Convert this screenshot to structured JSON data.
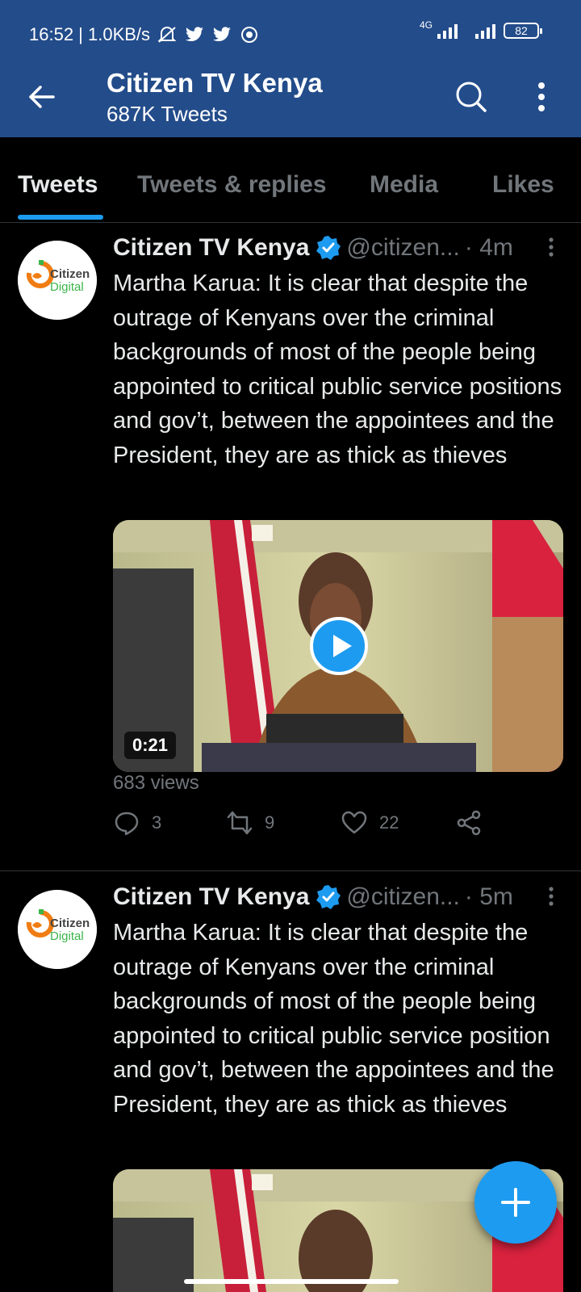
{
  "status_bar": {
    "time_speed": "16:52 | 1.0KB/s",
    "network_type": "4G",
    "battery_level": "82"
  },
  "header": {
    "title": "Citizen TV Kenya",
    "subtitle": "687K Tweets"
  },
  "tabs": [
    {
      "label": "Tweets",
      "active": true
    },
    {
      "label": "Tweets & replies",
      "active": false
    },
    {
      "label": "Media",
      "active": false
    },
    {
      "label": "Likes",
      "active": false
    }
  ],
  "avatar": {
    "brand_top": "Citizen",
    "brand_bottom": "Digital"
  },
  "tweets": [
    {
      "name": "Citizen TV Kenya",
      "handle": "@citizen...",
      "time": "· 4m",
      "text": "Martha Karua: It is clear that despite the outrage of Kenyans over the criminal backgrounds of most of the people being appointed to critical public service positions and gov’t, between the appointees and the President, they are as thick as thieves",
      "video_duration": "0:21",
      "views": "683 views",
      "replies": "3",
      "retweets": "9",
      "likes": "22"
    },
    {
      "name": "Citizen TV Kenya",
      "handle": "@citizen...",
      "time": "· 5m",
      "text": "Martha Karua: It is clear that despite the outrage of Kenyans over the criminal backgrounds of most of the people being appointed to critical public service position and gov’t, between the appointees and the President, they are as thick as thieves"
    }
  ],
  "colors": {
    "header_bg": "#234c8a",
    "accent": "#1d9bf0",
    "background": "#000000",
    "secondary_text": "#71767b"
  }
}
